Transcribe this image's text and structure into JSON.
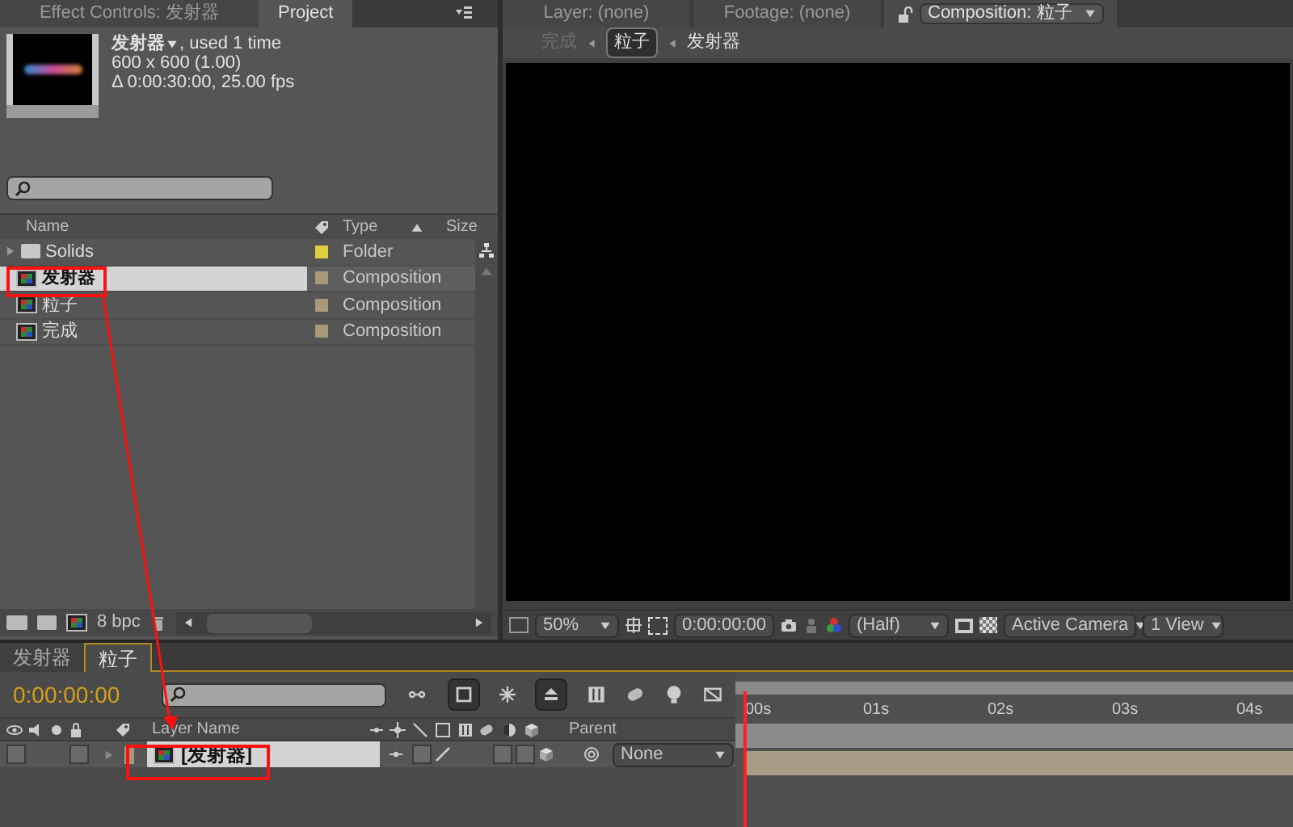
{
  "project_panel": {
    "tabs": [
      {
        "label": "Effect Controls: 发射器",
        "selected": false
      },
      {
        "label": "Project",
        "selected": true
      }
    ],
    "preview": {
      "name": "发射器",
      "usage": ", used 1 time",
      "dimensions": "600 x 600 (1.00)",
      "duration": "Δ 0:00:30:00, 25.00 fps"
    },
    "columns": [
      "Name",
      "Type",
      "Size"
    ],
    "items": [
      {
        "kind": "folder",
        "name": "Solids",
        "type": "Folder",
        "color": "#e0d040",
        "selected": false
      },
      {
        "kind": "composition",
        "name": "发射器",
        "type": "Composition",
        "color": "#a8987a",
        "selected": true
      },
      {
        "kind": "composition",
        "name": "粒子",
        "type": "Composition",
        "color": "#a8987a",
        "selected": false
      },
      {
        "kind": "composition",
        "name": "完成",
        "type": "Composition",
        "color": "#a8987a",
        "selected": false
      }
    ],
    "bit_depth": "8 bpc"
  },
  "viewer_panel": {
    "tabs": [
      {
        "label": "Layer: (none)",
        "selected": false
      },
      {
        "label": "Footage: (none)",
        "selected": false
      },
      {
        "label": "Composition: 粒子",
        "selected": true
      }
    ],
    "breadcrumbs": [
      {
        "label": "完成",
        "selected": false,
        "disabled": true
      },
      {
        "label": "粒子",
        "selected": true,
        "disabled": false
      },
      {
        "label": "发射器",
        "selected": false,
        "disabled": false
      }
    ],
    "toolbar": {
      "zoom": "50%",
      "timecode": "0:00:00:00",
      "resolution": "(Half)",
      "camera": "Active Camera",
      "views": "1 View"
    }
  },
  "timeline": {
    "tabs": [
      {
        "label": "发射器",
        "selected": false
      },
      {
        "label": "粒子",
        "selected": true
      }
    ],
    "timecode": "0:00:00:00",
    "layer_name_header": "Layer Name",
    "parent_header": "Parent",
    "ruler": [
      "00s",
      "01s",
      "02s",
      "03s",
      "04s"
    ],
    "layers": [
      {
        "name": "[发射器]",
        "selected": true,
        "parent": "None"
      }
    ]
  }
}
